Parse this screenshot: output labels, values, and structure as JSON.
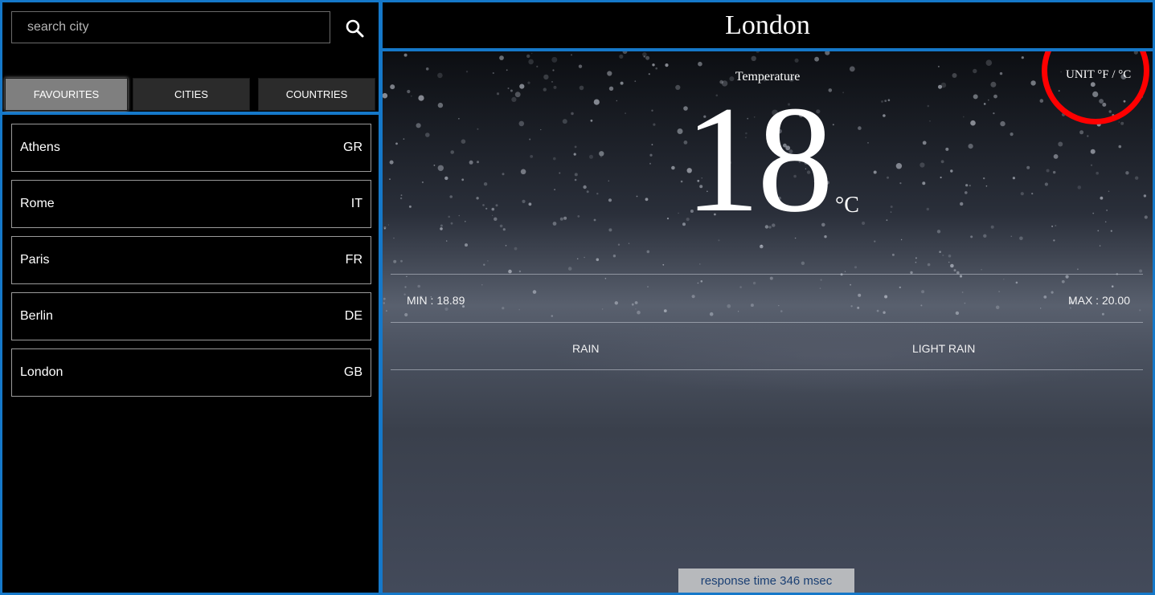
{
  "search": {
    "placeholder": "search city"
  },
  "tabs": [
    {
      "label": "FAVOURITES"
    },
    {
      "label": "CITIES"
    },
    {
      "label": "COUNTRIES"
    }
  ],
  "cities": [
    {
      "name": "Athens",
      "code": "GR"
    },
    {
      "name": "Rome",
      "code": "IT"
    },
    {
      "name": "Paris",
      "code": "FR"
    },
    {
      "name": "Berlin",
      "code": "DE"
    },
    {
      "name": "London",
      "code": "GB"
    }
  ],
  "weather": {
    "city": "London",
    "temperature_label": "Temperature",
    "unit_toggle": "UNIT °F / °C",
    "temperature": "18",
    "unit": "°C",
    "min": "MIN : 18.89",
    "max": "MAX : 20.00",
    "main": "RAIN",
    "description": "LIGHT RAIN",
    "response_time": "response time 346 msec"
  },
  "colors": {
    "panel_border": "#1578c9",
    "highlight_circle": "#ff0000",
    "active_tab": "#7f7f7f"
  },
  "icons": {
    "search": "search-icon"
  }
}
